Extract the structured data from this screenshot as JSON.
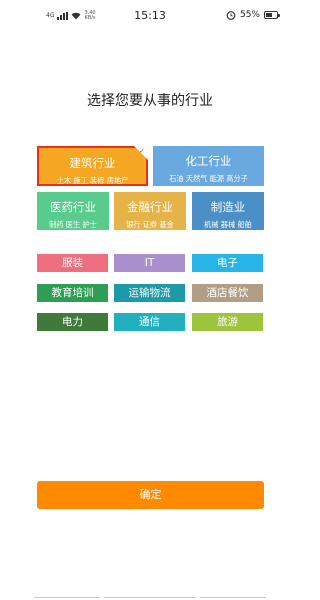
{
  "status_bar": {
    "network": "4G",
    "network2": "4G",
    "speed_value": "3.40",
    "speed_unit": "KB/s",
    "time": "15:13",
    "battery": "55%",
    "battery_level": 0.55,
    "icons": [
      "signal-icon",
      "wifi-icon",
      "alarm-icon",
      "battery-icon"
    ]
  },
  "page": {
    "title": "选择您要从事的行业"
  },
  "industries_large": [
    {
      "title": "建筑行业",
      "subtitle": "土木  施工  装修  房地产",
      "color": "#f5a623",
      "selected": true
    },
    {
      "title": "化工行业",
      "subtitle": "石油  天然气  能源  高分子",
      "color": "#6aa8e0",
      "selected": false
    },
    {
      "title": "医药行业",
      "subtitle": "制药  医生  护士",
      "color": "#58cc8c",
      "selected": false
    },
    {
      "title": "金融行业",
      "subtitle": "银行  证券  基金",
      "color": "#e6b349",
      "selected": false
    },
    {
      "title": "制造业",
      "subtitle": "机械  器械  船舶",
      "color": "#4a8fc6",
      "selected": false
    }
  ],
  "industries_small": [
    {
      "label": "服装",
      "color": "#ee6f80"
    },
    {
      "label": "IT",
      "color": "#a98fcc"
    },
    {
      "label": "电子",
      "color": "#27b5e8"
    },
    {
      "label": "教育培训",
      "color": "#2f9e55"
    },
    {
      "label": "运输物流",
      "color": "#1c9aa8"
    },
    {
      "label": "酒店餐饮",
      "color": "#b29e86"
    },
    {
      "label": "电力",
      "color": "#3f7a3b"
    },
    {
      "label": "通信",
      "color": "#22b0c0"
    },
    {
      "label": "旅游",
      "color": "#9dc43a"
    }
  ],
  "confirm": {
    "label": "确定",
    "color": "#ff8a00"
  }
}
